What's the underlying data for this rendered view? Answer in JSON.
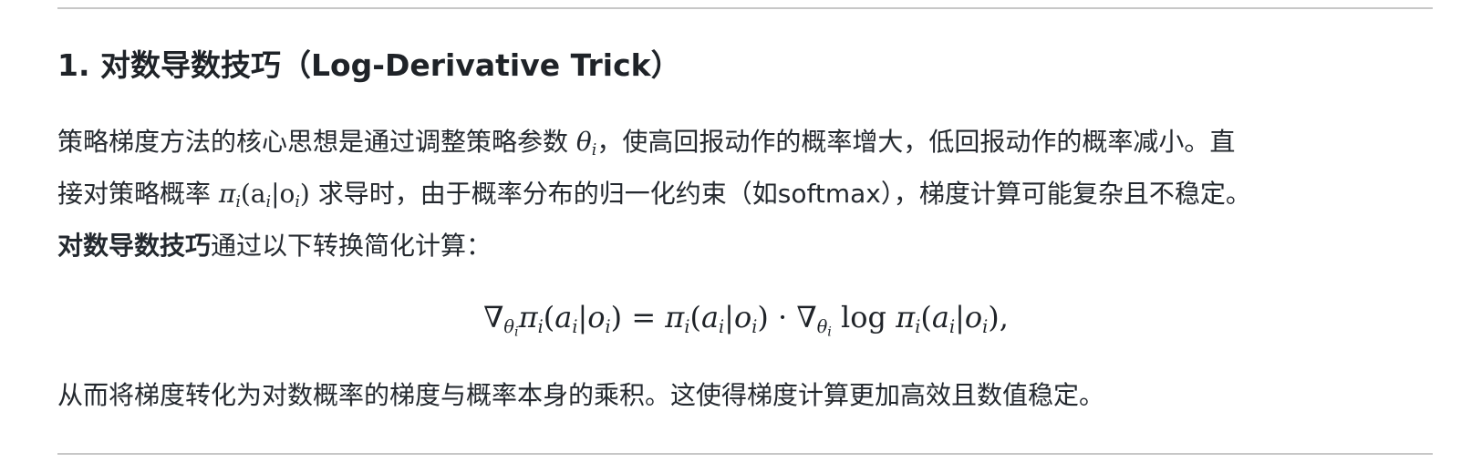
{
  "section": {
    "heading": "1. 对数导数技巧（Log-Derivative Trick）"
  },
  "paragraph1": {
    "line1_pre": "策略梯度方法的核心思想是通过调整策略参数 ",
    "line1_math_sym": "θ",
    "line1_math_sub": "i",
    "line1_post": "，使高回报动作的概率增大，低回报动作的概率减小。直",
    "line2_pre": "接对策略概率 ",
    "line2_math": "π",
    "line2_math_sub": "i",
    "line2_math_args": "(a",
    "line2_math_args_sub": "i",
    "line2_math_args2": "|o",
    "line2_math_args2_sub": "i",
    "line2_math_close": ")",
    "line2_post": " 求导时，由于概率分布的归一化约束（如softmax），梯度计算可能复杂且不稳定。",
    "line3_bold": "对数导数技巧",
    "line3_post": "通过以下转换简化计算："
  },
  "formula": {
    "nabla": "∇",
    "theta": "θ",
    "i": "i",
    "pi": "π",
    "a": "a",
    "o": "o",
    "equals": " = ",
    "cdot": " · ",
    "log": " log ",
    "trailing": ","
  },
  "paragraph2": {
    "text": "从而将梯度转化为对数概率的梯度与概率本身的乘积。这使得梯度计算更加高效且数值稳定。"
  }
}
